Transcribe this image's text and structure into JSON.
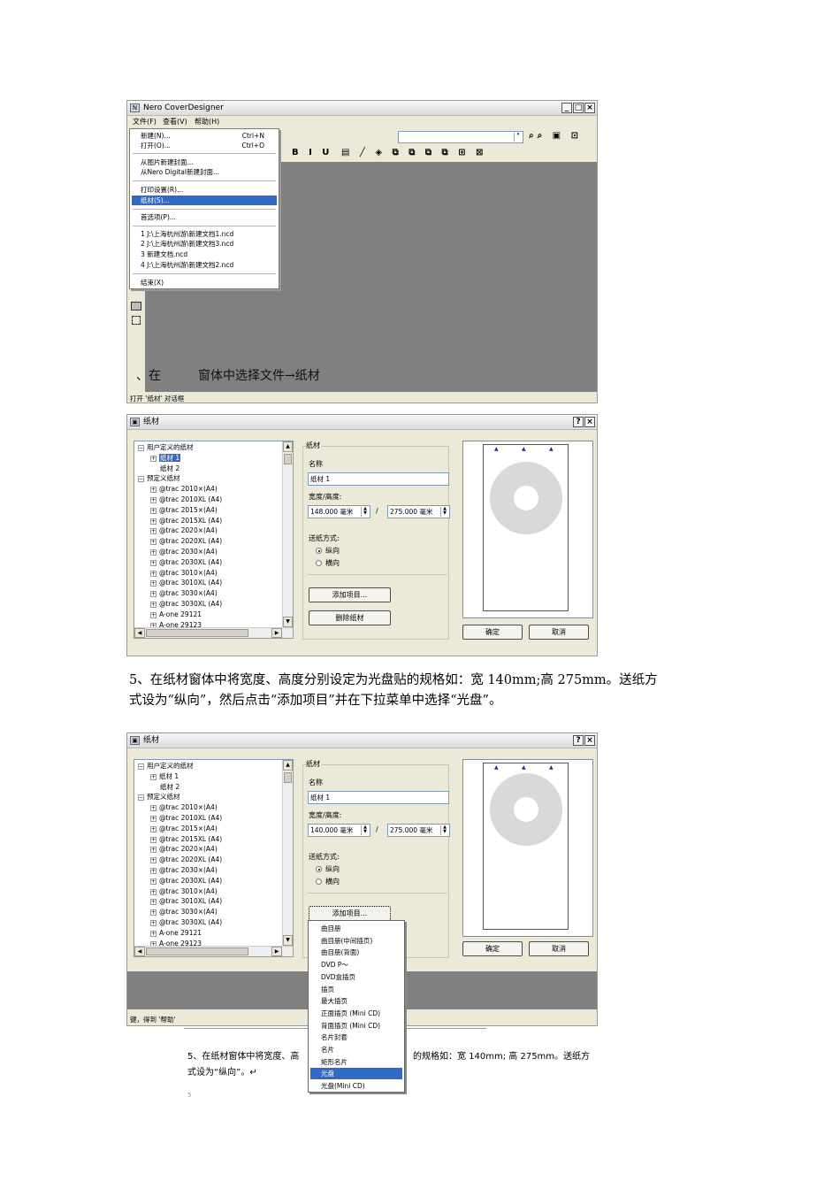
{
  "shot1": {
    "app_title": "Nero CoverDesigner",
    "menubar": [
      "文件(F)",
      "查看(V)",
      "帮助(H)"
    ],
    "window_buttons": [
      "_",
      "□",
      "×"
    ],
    "file_menu": [
      {
        "label": "新建(N)...",
        "shortcut": "Ctrl+N"
      },
      {
        "label": "打开(O)...",
        "shortcut": "Ctrl+O"
      },
      {
        "label": "从图片新建封面...",
        "shortcut": ""
      },
      {
        "label": "从Nero Digital新建封面...",
        "shortcut": ""
      },
      {
        "label": "打印设置(R)...",
        "shortcut": ""
      },
      {
        "label": "纸材(S)...",
        "shortcut": ""
      },
      {
        "label": "首选项(P)...",
        "shortcut": ""
      },
      {
        "label": "1 J:\\上海杭州游\\新建文档1.ncd",
        "shortcut": ""
      },
      {
        "label": "2 J:\\上海杭州游\\新建文档3.ncd",
        "shortcut": ""
      },
      {
        "label": "3 新建文档.ncd",
        "shortcut": ""
      },
      {
        "label": "4 J:\\上海杭州游\\新建文档2.ncd",
        "shortcut": ""
      },
      {
        "label": "结束(X)",
        "shortcut": ""
      }
    ],
    "toolbar_glyphs": "B I U",
    "overlay_text": "、在　　　窗体中选择文件→纸材",
    "status_text": "打开 '纸材' 对话框"
  },
  "dialog": {
    "title": "纸材",
    "title_buttons": [
      "?",
      "×"
    ],
    "tree": {
      "user_group": "用户定义的纸材",
      "user_items": [
        "纸材 1",
        "纸材 2"
      ],
      "preset_group": "预定义纸材",
      "preset_items": [
        "@trac 2010×(A4)",
        "@trac 2010XL (A4)",
        "@trac 2015×(A4)",
        "@trac 2015XL (A4)",
        "@trac 2020×(A4)",
        "@trac 2020XL (A4)",
        "@trac 2030×(A4)",
        "@trac 2030XL (A4)",
        "@trac 3010×(A4)",
        "@trac 3010XL (A4)",
        "@trac 3030×(A4)",
        "@trac 3030XL (A4)",
        "A-one 29121",
        "A-one 29123"
      ]
    },
    "group_label": "纸材",
    "name_label": "名称",
    "name_value": "纸材 1",
    "size_label": "宽度/高度:",
    "width_value": "148.000 毫米",
    "width_value_2": "140.000 毫米",
    "height_value": "275.000 毫米",
    "separator": "/",
    "feed_label": "送纸方式:",
    "feed_options": [
      "纵向",
      "横向"
    ],
    "add_button": "添加项目...",
    "delete_button": "删除纸材",
    "ok_button": "确定",
    "cancel_button": "取消"
  },
  "caption_main": {
    "line1": "5、在纸材窗体中将宽度、高度分别设定为光盘贴的规格如：宽 140mm;高 275mm。送纸方",
    "line2": "式设为“纵向”，然后点击“添加项目”并在下拉菜单中选择“光盘”。"
  },
  "shot3": {
    "popup_items": [
      "曲目册",
      "曲目册(中间插页)",
      "曲目册(背面)",
      "DVD P〜",
      "DVD盒插页",
      "插页",
      "最大插页",
      "正面插页 (Mini CD)",
      "背面插页 (Mini CD)",
      "名片封套",
      "名片",
      "矩形名片",
      "光盘",
      "光盘(Mini CD)"
    ],
    "popup_selected": "光盘",
    "status_text": "键，得到 '帮助'",
    "bottom_caption_left": "5、在纸材窗体中将宽度、高",
    "bottom_caption_right": "的规格如：宽 140mm; 高 275mm。送纸方",
    "bottom_caption_line2": "式设为“纵向”。↵",
    "bottom_fragment": "5"
  }
}
